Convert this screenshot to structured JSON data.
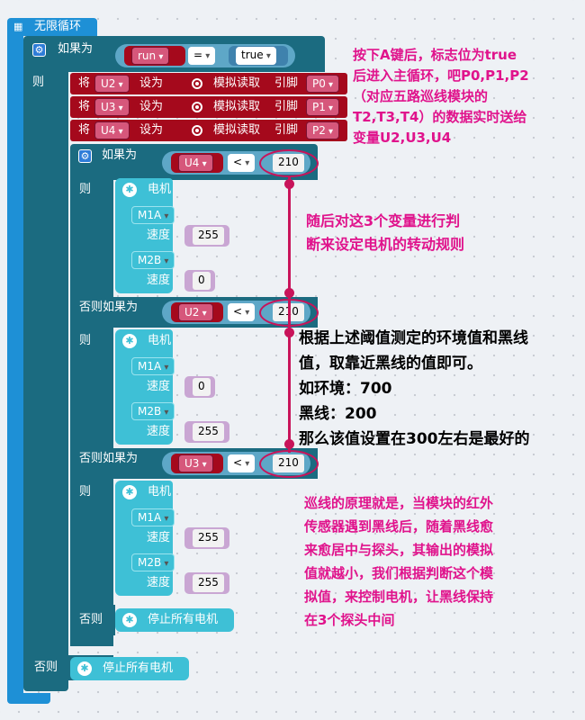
{
  "header": {
    "loop_label": "无限循环"
  },
  "outer_if": {
    "if_label": "如果为",
    "then_label": "则",
    "else_label": "否则",
    "cond_var": "run",
    "cond_op": "=",
    "cond_value": "true",
    "else_action": "停止所有电机"
  },
  "assign_rows": [
    {
      "set_label": "将",
      "var": "U2",
      "to_label": "设为",
      "read_label": "模拟读取",
      "pin_label": "引脚",
      "pin": "P0"
    },
    {
      "set_label": "将",
      "var": "U3",
      "to_label": "设为",
      "read_label": "模拟读取",
      "pin_label": "引脚",
      "pin": "P1"
    },
    {
      "set_label": "将",
      "var": "U4",
      "to_label": "设为",
      "read_label": "模拟读取",
      "pin_label": "引脚",
      "pin": "P2"
    }
  ],
  "inner_if": {
    "if_label": "如果为",
    "then_label": "则",
    "elseif_label": "否则如果为",
    "else_label": "否则",
    "else_action": "停止所有电机",
    "branches": [
      {
        "var": "U4",
        "op": "<",
        "value": "210",
        "motor": {
          "title": "电机",
          "m1": "M1A",
          "m1_speed": "255",
          "m2": "M2B",
          "m2_speed": "0",
          "speed_label": "速度"
        }
      },
      {
        "var": "U2",
        "op": "<",
        "value": "210",
        "motor": {
          "title": "电机",
          "m1": "M1A",
          "m1_speed": "0",
          "m2": "M2B",
          "m2_speed": "255",
          "speed_label": "速度"
        }
      },
      {
        "var": "U3",
        "op": "<",
        "value": "210",
        "motor": {
          "title": "电机",
          "m1": "M1A",
          "m1_speed": "255",
          "m2": "M2B",
          "m2_speed": "255",
          "speed_label": "速度"
        }
      }
    ]
  },
  "annotations": {
    "top": [
      "按下A键后，标志位为true",
      "后进入主循环，吧P0,P1,P2",
      "（对应五路巡线模块的",
      "T2,T3,T4）的数据实时送给",
      "变量U2,U3,U4"
    ],
    "middle": [
      "随后对这3个变量进行判",
      "断来设定电机的转动规则"
    ],
    "threshold": [
      "根据上述阈值测定的环境值和黑线",
      "值，取靠近黑线的值即可。",
      "如环境：700",
      "黑线：200",
      "那么该值设置在300左右是最好的"
    ],
    "principle": [
      "巡线的原理就是，当模块的红外",
      "传感器遇到黑线后，随着黑线愈",
      "来愈居中与探头，其输出的模拟",
      "值就越小，我们根据判断这个模",
      "拟值，来控制电机，让黑线保持",
      "在3个探头中间"
    ]
  },
  "colors": {
    "loop": "#1e90d6",
    "logic": "#1b6b80",
    "motor": "#3ec0d6",
    "variable": "#a5091c",
    "annotation": "#e0138c",
    "highlight": "#c8145a"
  }
}
